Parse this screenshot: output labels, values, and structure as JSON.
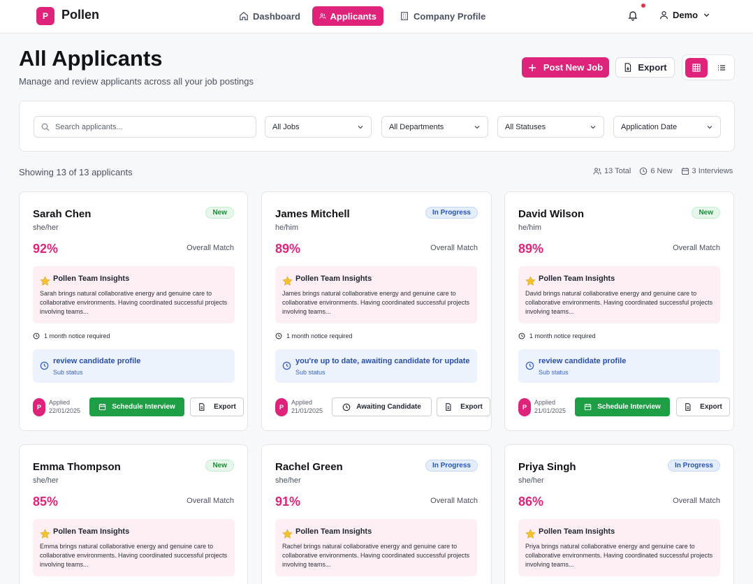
{
  "nav": {
    "logo_letter": "P",
    "brand": "Pollen",
    "links": [
      {
        "label": "Dashboard",
        "icon": "home-icon"
      },
      {
        "label": "Applicants",
        "icon": "users-icon",
        "active": true
      },
      {
        "label": "Company Profile",
        "icon": "building-icon"
      }
    ],
    "user": "Demo"
  },
  "header": {
    "title": "All Applicants",
    "subtitle": "Manage and review applicants across all your job postings",
    "post_job": "Post New Job",
    "export": "Export"
  },
  "filters": {
    "search_placeholder": "Search applicants...",
    "jobs": "All Jobs",
    "departments": "All Departments",
    "statuses": "All Statuses",
    "date": "Application Date"
  },
  "summary": {
    "showing": "Showing 13 of 13 applicants",
    "total": "13 Total",
    "new": "6 New",
    "interviews": "3 Interviews"
  },
  "labels": {
    "overall_match": "Overall Match",
    "insights_title": "Pollen Team Insights",
    "notice": "1 month notice required",
    "sub_status": "Sub status",
    "applied": "Applied",
    "schedule": "Schedule Interview",
    "awaiting": "Awaiting Candidate",
    "export": "Export"
  },
  "cards": [
    {
      "name": "Sarah Chen",
      "pronouns": "she/her",
      "badge": "New",
      "match": "92%",
      "insight": "Sarah brings natural collaborative energy and genuine care to collaborative environments. Having coordinated successful projects involving teams...",
      "status": "review candidate profile",
      "avatar": "P",
      "date": "22/01/2025"
    },
    {
      "name": "James Mitchell",
      "pronouns": "he/him",
      "badge": "In Progress",
      "match": "89%",
      "insight": "James brings natural collaborative energy and genuine care to collaborative environments. Having coordinated successful projects involving teams...",
      "status": "you're up to date, awaiting candidate for update",
      "avatar": "P",
      "date": "21/01/2025"
    },
    {
      "name": "David Wilson",
      "pronouns": "he/him",
      "badge": "New",
      "match": "89%",
      "insight": "David brings natural collaborative energy and genuine care to collaborative environments. Having coordinated successful projects involving teams...",
      "status": "review candidate profile",
      "avatar": "P",
      "date": "21/01/2025"
    },
    {
      "name": "Emma Thompson",
      "pronouns": "she/her",
      "badge": "New",
      "match": "85%",
      "insight": "Emma brings natural collaborative energy and genuine care to collaborative environments. Having coordinated successful projects involving teams..."
    },
    {
      "name": "Rachel Green",
      "pronouns": "she/her",
      "badge": "In Progress",
      "match": "91%",
      "insight": "Rachel brings natural collaborative energy and genuine care to collaborative environments. Having coordinated successful projects involving teams..."
    },
    {
      "name": "Priya Singh",
      "pronouns": "she/her",
      "badge": "In Progress",
      "match": "86%",
      "insight": "Priya brings natural collaborative energy and genuine care to collaborative environments. Having coordinated successful projects involving teams..."
    }
  ]
}
